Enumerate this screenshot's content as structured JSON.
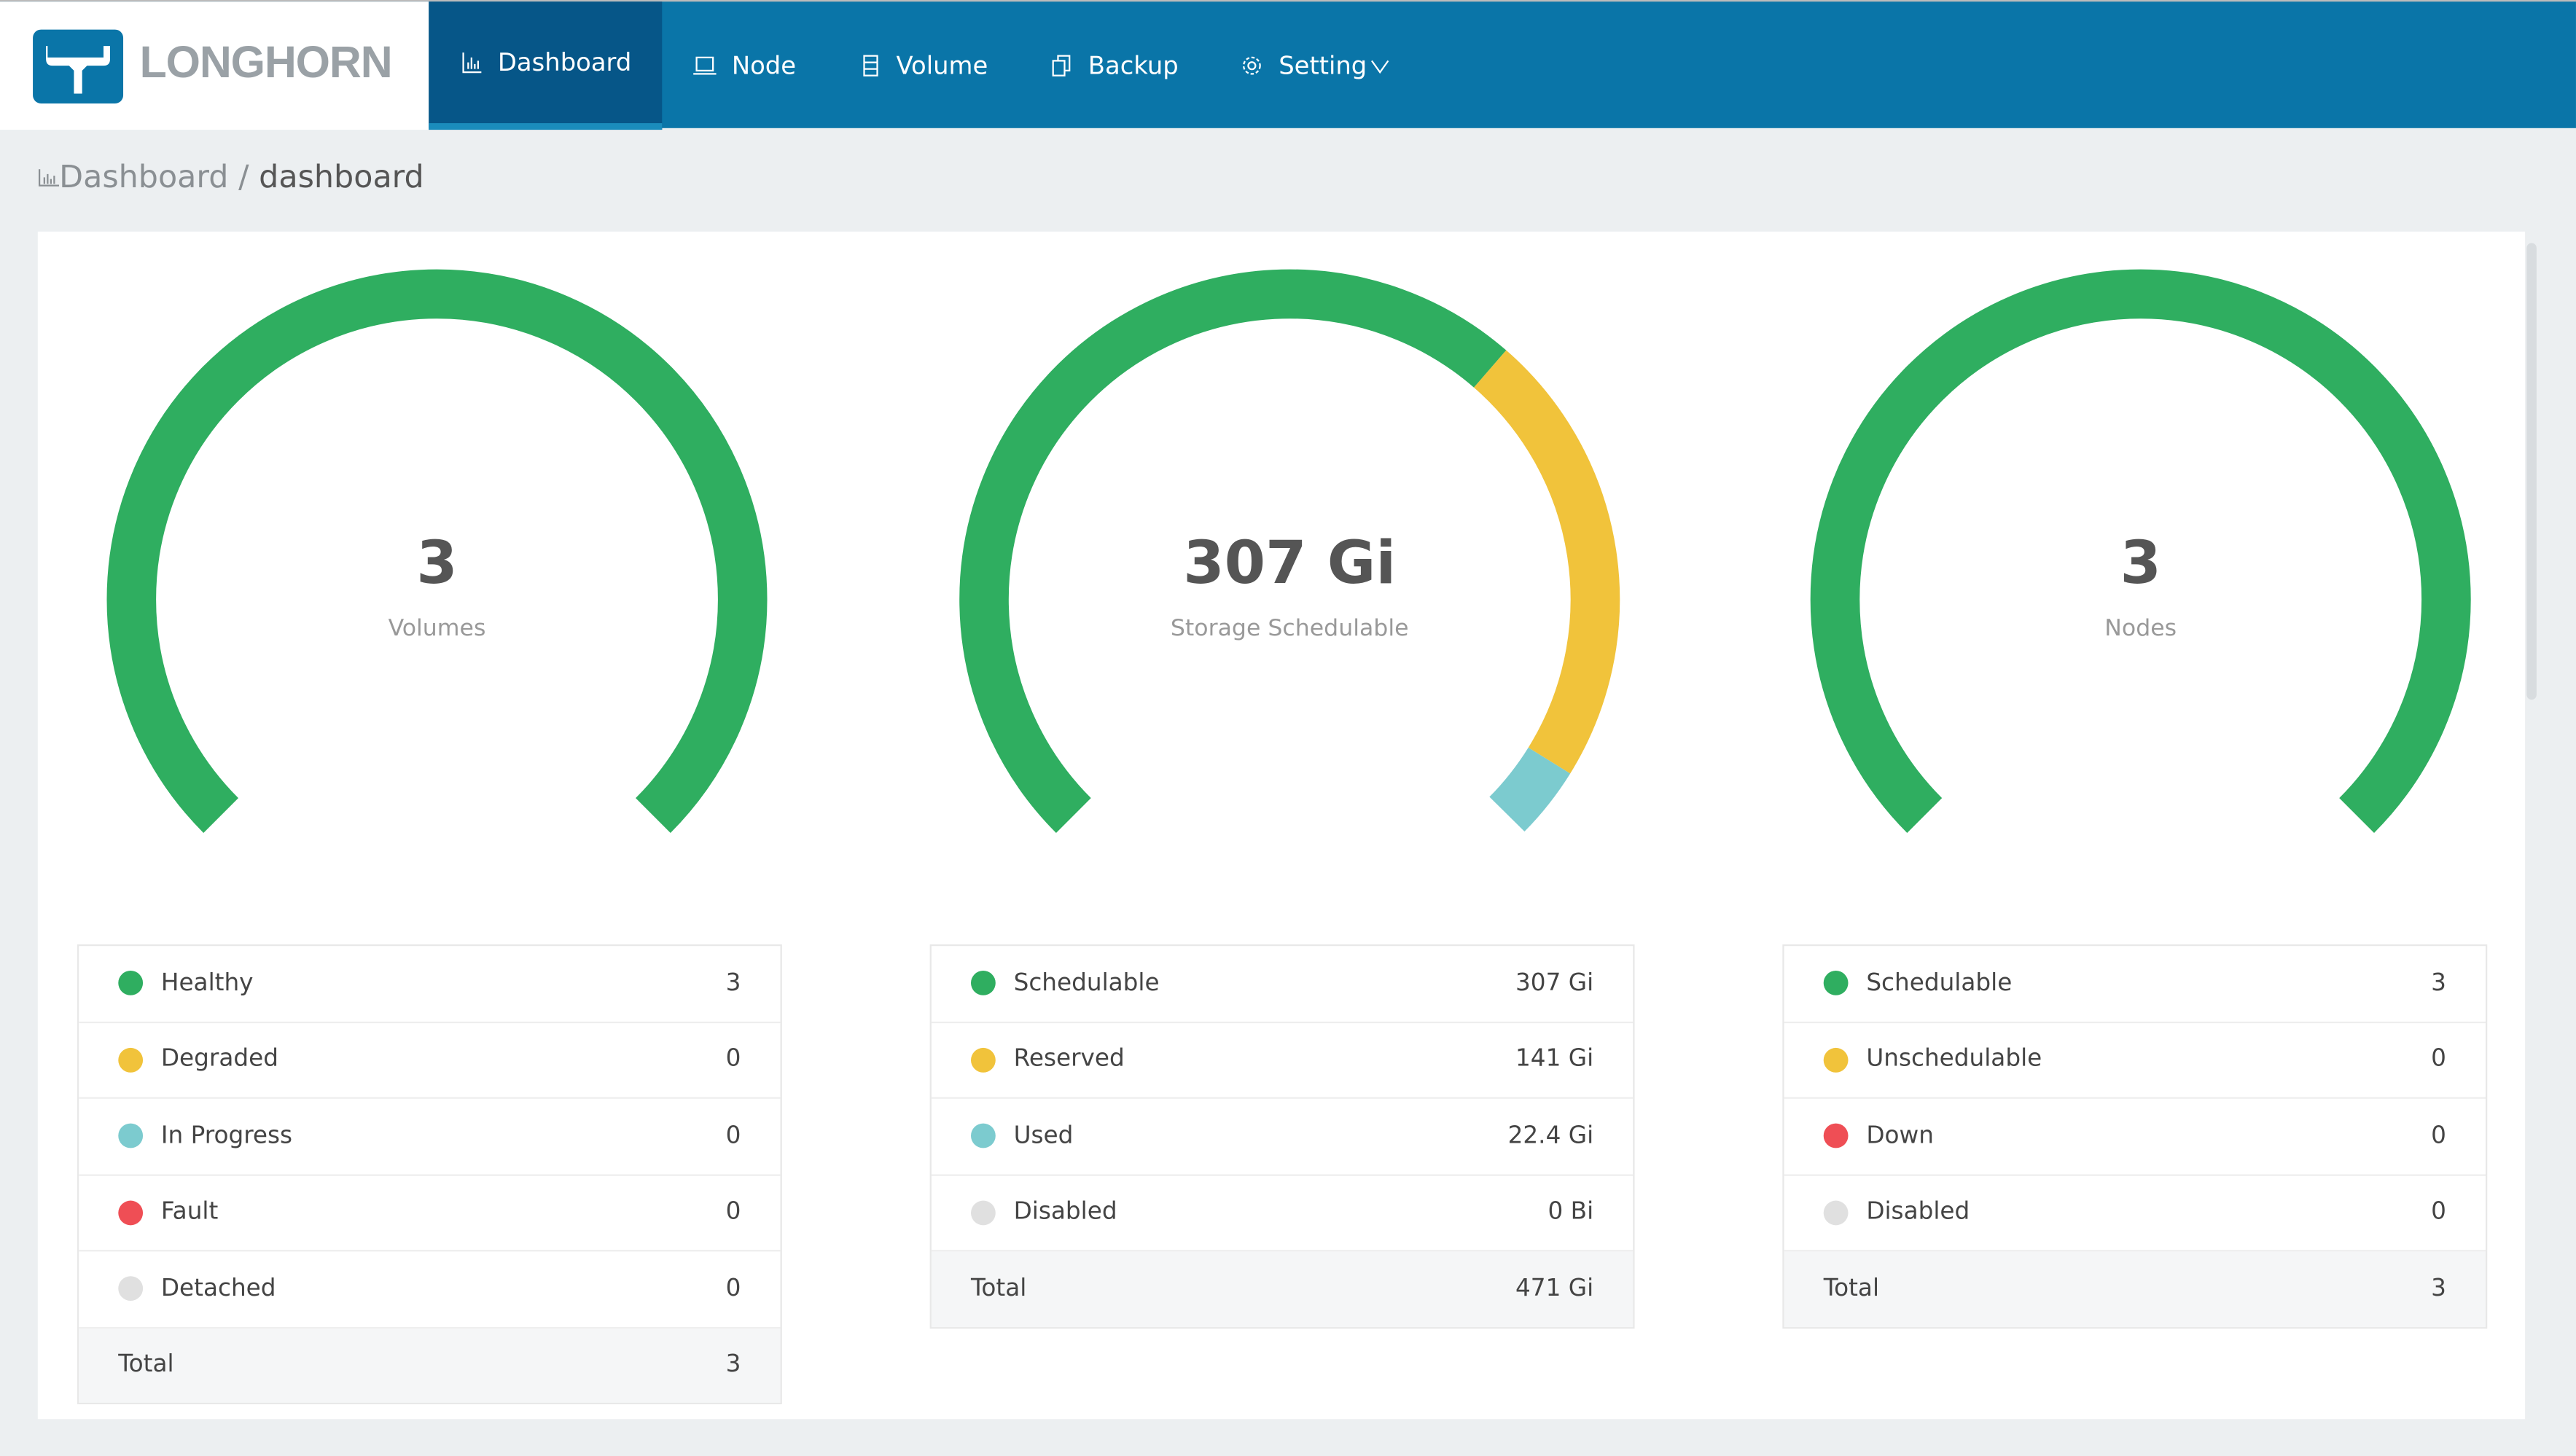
{
  "brand": {
    "name": "LONGHORN"
  },
  "nav": [
    {
      "label": "Dashboard",
      "icon": "bar-chart-icon",
      "active": true
    },
    {
      "label": "Node",
      "icon": "laptop-icon"
    },
    {
      "label": "Volume",
      "icon": "database-icon"
    },
    {
      "label": "Backup",
      "icon": "copy-icon"
    },
    {
      "label": "Setting",
      "icon": "gear-icon",
      "dropdown": true
    }
  ],
  "breadcrumb": {
    "root": "Dashboard",
    "separator": "/",
    "current": "dashboard"
  },
  "colors": {
    "green": "#2fae60",
    "yellow": "#f1c33b",
    "cyan": "#7ccbcf",
    "red": "#ef4e55",
    "gray": "#e0e0e0"
  },
  "gauges": [
    {
      "value": "3",
      "label": "Volumes",
      "segments": [
        {
          "color": "#2fae60",
          "amount": 3
        }
      ],
      "total": 3,
      "rows": [
        {
          "label": "Healthy",
          "value": "3",
          "color": "#2fae60"
        },
        {
          "label": "Degraded",
          "value": "0",
          "color": "#f1c33b"
        },
        {
          "label": "In Progress",
          "value": "0",
          "color": "#7ccbcf"
        },
        {
          "label": "Fault",
          "value": "0",
          "color": "#ef4e55"
        },
        {
          "label": "Detached",
          "value": "0",
          "color": "#e0e0e0"
        }
      ],
      "total_label": "Total",
      "total_value": "3"
    },
    {
      "value": "307 Gi",
      "label": "Storage Schedulable",
      "segments": [
        {
          "color": "#2fae60",
          "amount": 307
        },
        {
          "color": "#f1c33b",
          "amount": 141
        },
        {
          "color": "#7ccbcf",
          "amount": 22.4
        }
      ],
      "total": 471,
      "rows": [
        {
          "label": "Schedulable",
          "value": "307 Gi",
          "color": "#2fae60"
        },
        {
          "label": "Reserved",
          "value": "141 Gi",
          "color": "#f1c33b"
        },
        {
          "label": "Used",
          "value": "22.4 Gi",
          "color": "#7ccbcf"
        },
        {
          "label": "Disabled",
          "value": "0 Bi",
          "color": "#e0e0e0"
        }
      ],
      "total_label": "Total",
      "total_value": "471 Gi"
    },
    {
      "value": "3",
      "label": "Nodes",
      "segments": [
        {
          "color": "#2fae60",
          "amount": 3
        }
      ],
      "total": 3,
      "rows": [
        {
          "label": "Schedulable",
          "value": "3",
          "color": "#2fae60"
        },
        {
          "label": "Unschedulable",
          "value": "0",
          "color": "#f1c33b"
        },
        {
          "label": "Down",
          "value": "0",
          "color": "#ef4e55"
        },
        {
          "label": "Disabled",
          "value": "0",
          "color": "#e0e0e0"
        }
      ],
      "total_label": "Total",
      "total_value": "3"
    }
  ]
}
